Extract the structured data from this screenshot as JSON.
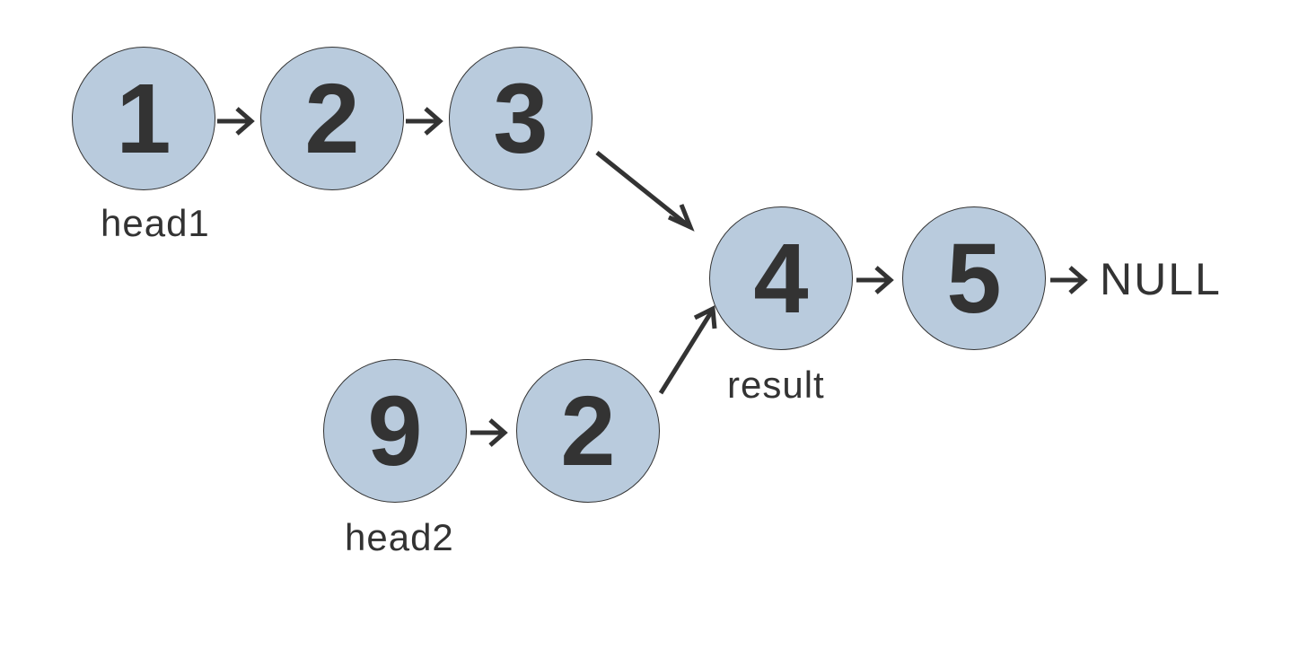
{
  "nodes": {
    "list1": [
      "1",
      "2",
      "3"
    ],
    "list2": [
      "9",
      "2"
    ],
    "merged": [
      "4",
      "5"
    ]
  },
  "labels": {
    "head1": "head1",
    "head2": "head2",
    "result": "result",
    "null": "NULL"
  },
  "colors": {
    "node_fill": "#b9cbdd",
    "node_stroke": "#333333",
    "text": "#333333"
  }
}
